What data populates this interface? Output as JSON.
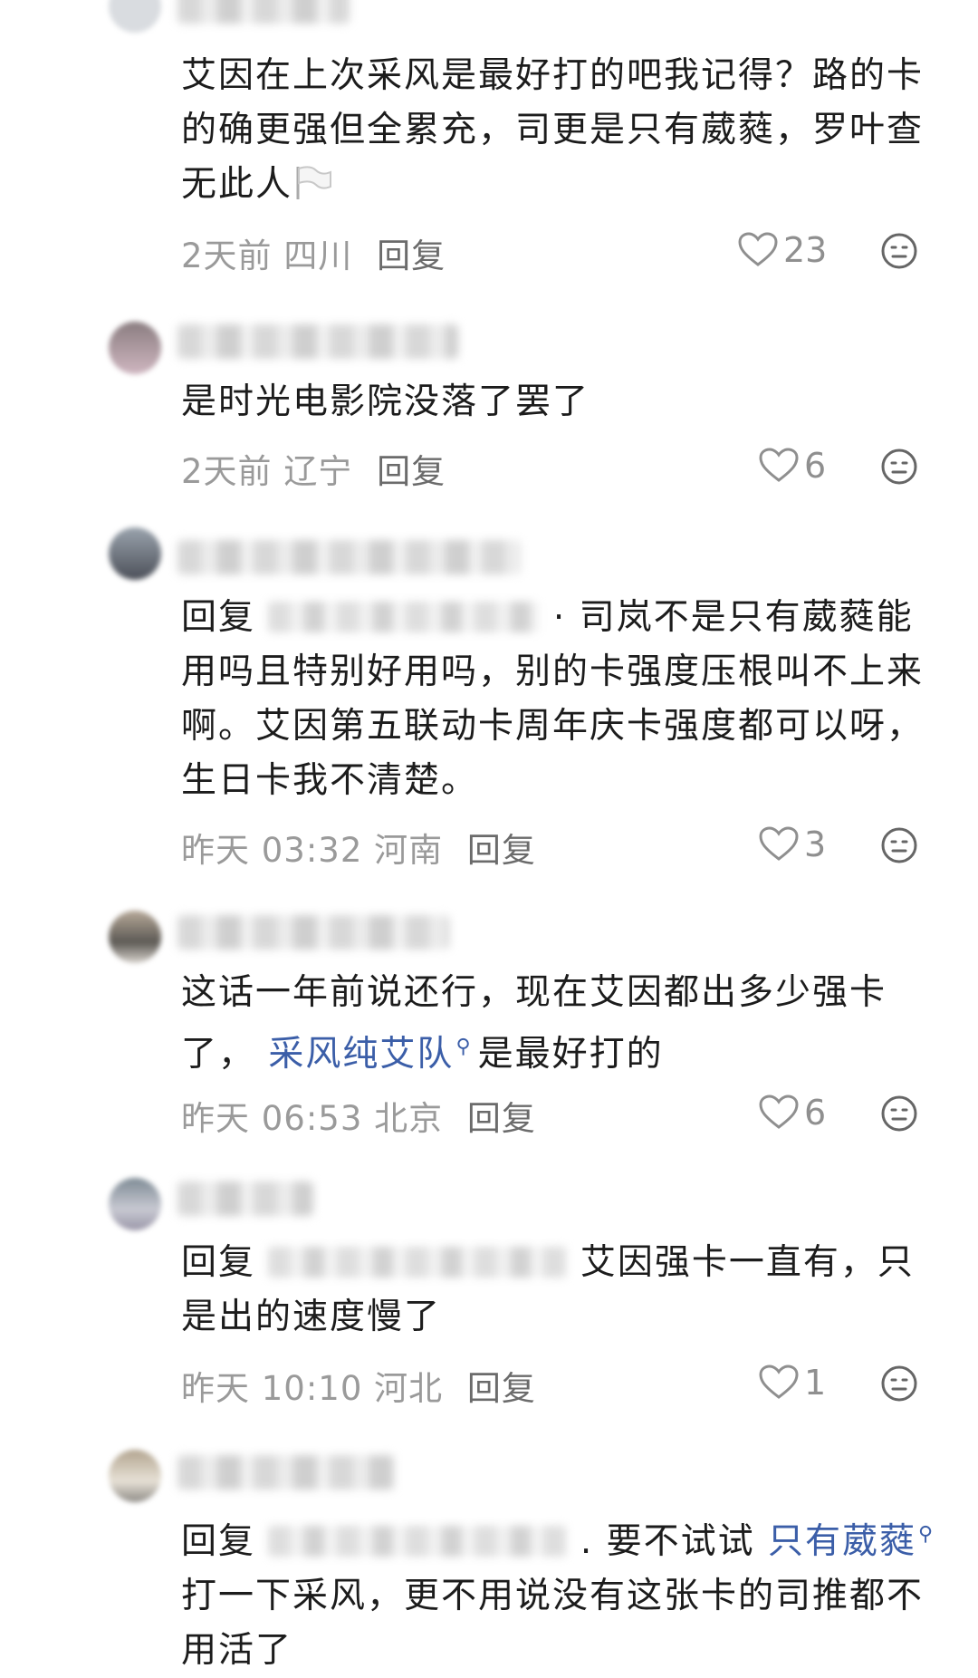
{
  "comments": [
    {
      "text_parts": [
        "艾因在上次采风是最好打的吧我记得？路的卡的确更强但全累充，司更是只有葳蕤，罗叶查无此人"
      ],
      "meta": {
        "time": "2天前",
        "location": "四川",
        "reply_label": "回复"
      },
      "likes": "23"
    },
    {
      "text_parts": [
        "是时光电影院没落了罢了"
      ],
      "meta": {
        "time": "2天前",
        "location": "辽宁",
        "reply_label": "回复"
      },
      "likes": "6"
    },
    {
      "reply_prefix": "回复",
      "text_parts": [
        "· 司岚不是只有葳蕤能用吗且特别好用吗，别的卡强度压根叫不上来啊。艾因第五联动卡周年庆卡强度都可以呀，生日卡我不清楚。"
      ],
      "meta": {
        "time": "昨天 03:32",
        "location": "河南",
        "reply_label": "回复"
      },
      "likes": "3"
    },
    {
      "text_parts": [
        "这话一年前说还行，现在艾因都出多少强卡了，",
        "是最好打的"
      ],
      "link": "采风纯艾队",
      "meta": {
        "time": "昨天 06:53",
        "location": "北京",
        "reply_label": "回复"
      },
      "likes": "6"
    },
    {
      "reply_prefix": "回复",
      "text_parts": [
        "艾因强卡一直有，只是出的速度慢了"
      ],
      "meta": {
        "time": "昨天 10:10",
        "location": "河北",
        "reply_label": "回复"
      },
      "likes": "1"
    },
    {
      "reply_prefix": "回复",
      "text_parts": [
        ". 要不试试",
        "打一下采风，更不用说没有这张卡的司推都不用活了"
      ],
      "link": "只有葳蕤"
    }
  ]
}
